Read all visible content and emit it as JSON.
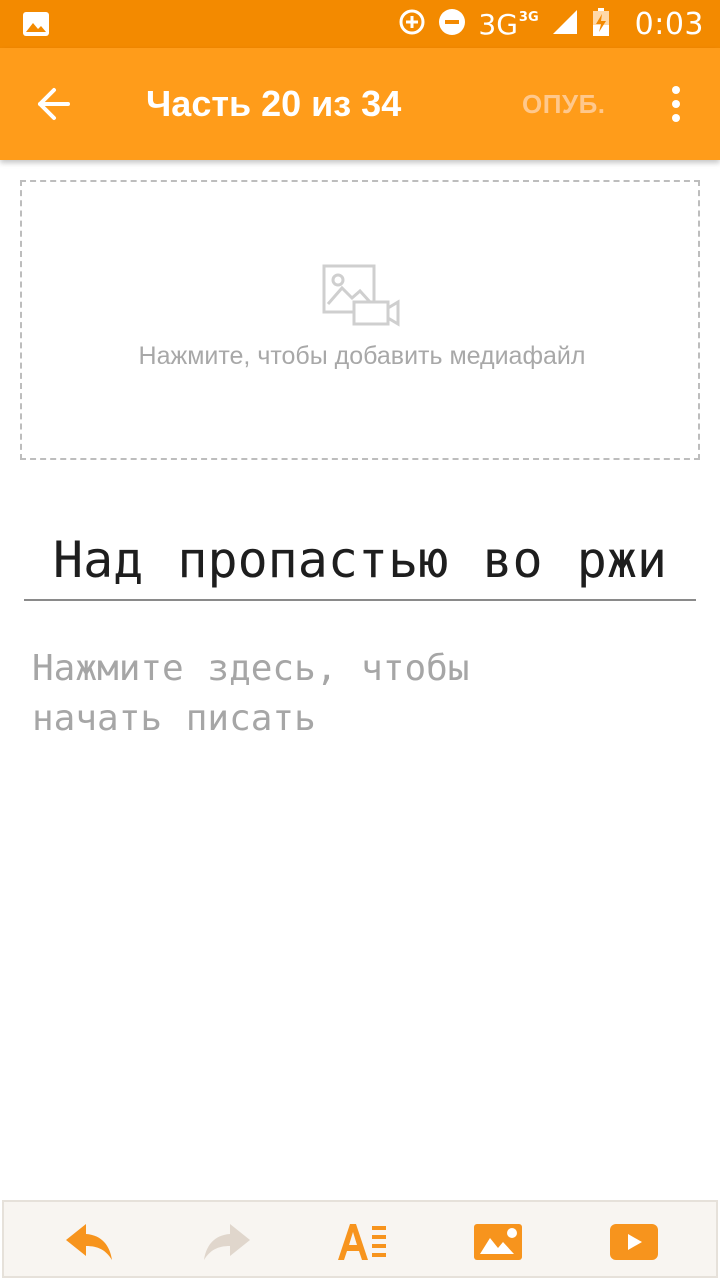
{
  "status_bar": {
    "network": "3G",
    "network_sup": "3G",
    "time": "0:03"
  },
  "toolbar": {
    "title": "Часть 20 из 34",
    "publish_label": "ОПУБ."
  },
  "media": {
    "label": "Нажмите, чтобы добавить медиафайл"
  },
  "editor": {
    "title_value": "Над пропастью во ржи",
    "body_placeholder": "Нажмите здесь, чтобы\nначать писать"
  },
  "colors": {
    "status_bar": "#f38a00",
    "toolbar": "#ff9c1a",
    "accent": "#f7941d",
    "disabled": "#e0d6cc"
  }
}
